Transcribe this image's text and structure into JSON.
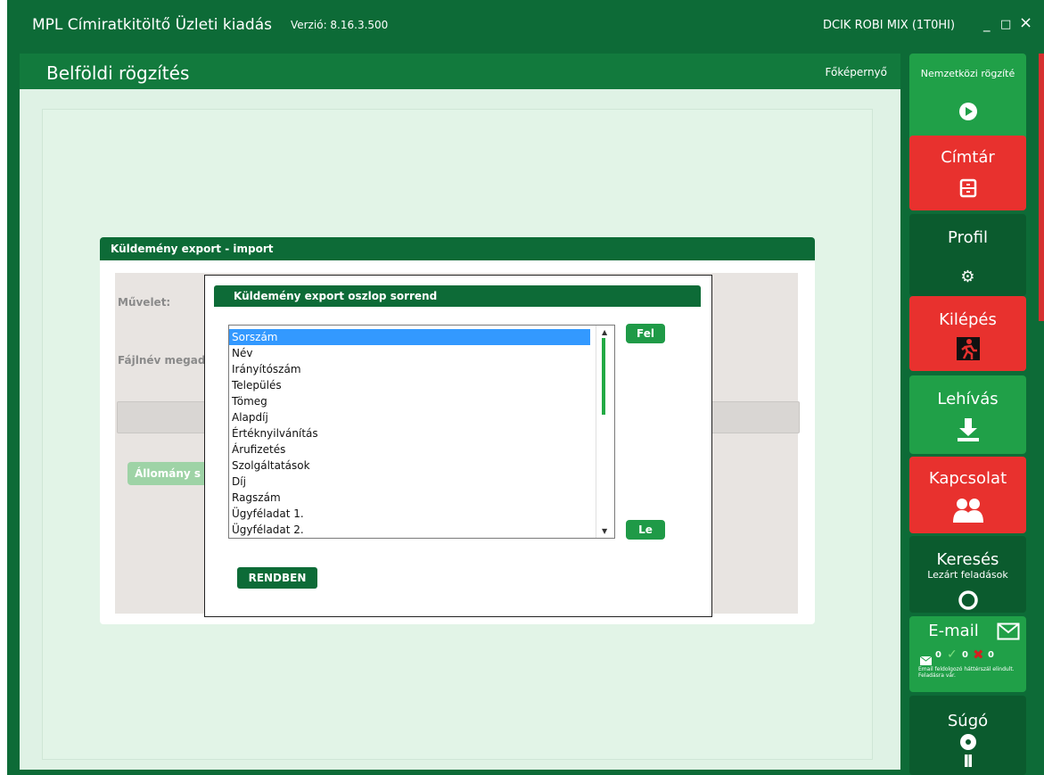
{
  "window": {
    "title": "MPL Címiratkitöltő Üzleti kiadás",
    "version": "Verzió: 8.16.3.500",
    "user": "DCIK ROBI MIX (1T0HI)",
    "controls": {
      "minimize": "_",
      "maximize": "□",
      "close": "×"
    }
  },
  "header": {
    "title": "Belföldi rögzítés",
    "home_link": "Főképernyő"
  },
  "export_dialog": {
    "title": "Küldemény export - import",
    "label_operation": "Művelet:",
    "label_filename": "Fájlnév megadá",
    "file_button": "Állomány s"
  },
  "order_dialog": {
    "title": "Küldemény export oszlop sorrend",
    "columns": [
      "Sorszám",
      "Név",
      "Irányítószám",
      "Település",
      "Tömeg",
      "Alapdíj",
      "Értéknyilvánítás",
      "Árufizetés",
      "Szolgáltatások",
      "Díj",
      "Ragszám",
      "Ügyféladat 1.",
      "Ügyféladat 2."
    ],
    "selected_index": 0,
    "up_button": "Fel",
    "down_button": "Le",
    "ok_button": "RENDBEN"
  },
  "sidebar": {
    "international": {
      "label": "Nemzetközi rögzíté",
      "icon": "play-circle-icon",
      "color": "#20a048"
    },
    "directory": {
      "label": "Címtár",
      "icon": "cabinet-icon",
      "color": "#e8312e"
    },
    "profile": {
      "label": "Profil",
      "icon": "gear-icon",
      "color": "#0b5b2e"
    },
    "logout": {
      "label": "Kilépés",
      "icon": "exit-icon",
      "color": "#e8312e"
    },
    "fetch": {
      "label": "Lehívás",
      "icon": "download-icon",
      "color": "#20a048"
    },
    "contact": {
      "label": "Kapcsolat",
      "icon": "people-icon",
      "color": "#e8312e"
    },
    "search": {
      "label": "Keresés",
      "sub": "Lezárt feladások",
      "icon": "search-icon",
      "color": "#0b5b2e"
    },
    "email": {
      "label": "E-mail",
      "count_mail": "0",
      "count_ok": "0",
      "count_err": "0",
      "note": "Email feldolgozó háttérszál elindult. Feladásra vár.",
      "color": "#20a048"
    },
    "help": {
      "label": "Súgó",
      "icon": "info-icon",
      "color": "#0b5b2e"
    }
  }
}
